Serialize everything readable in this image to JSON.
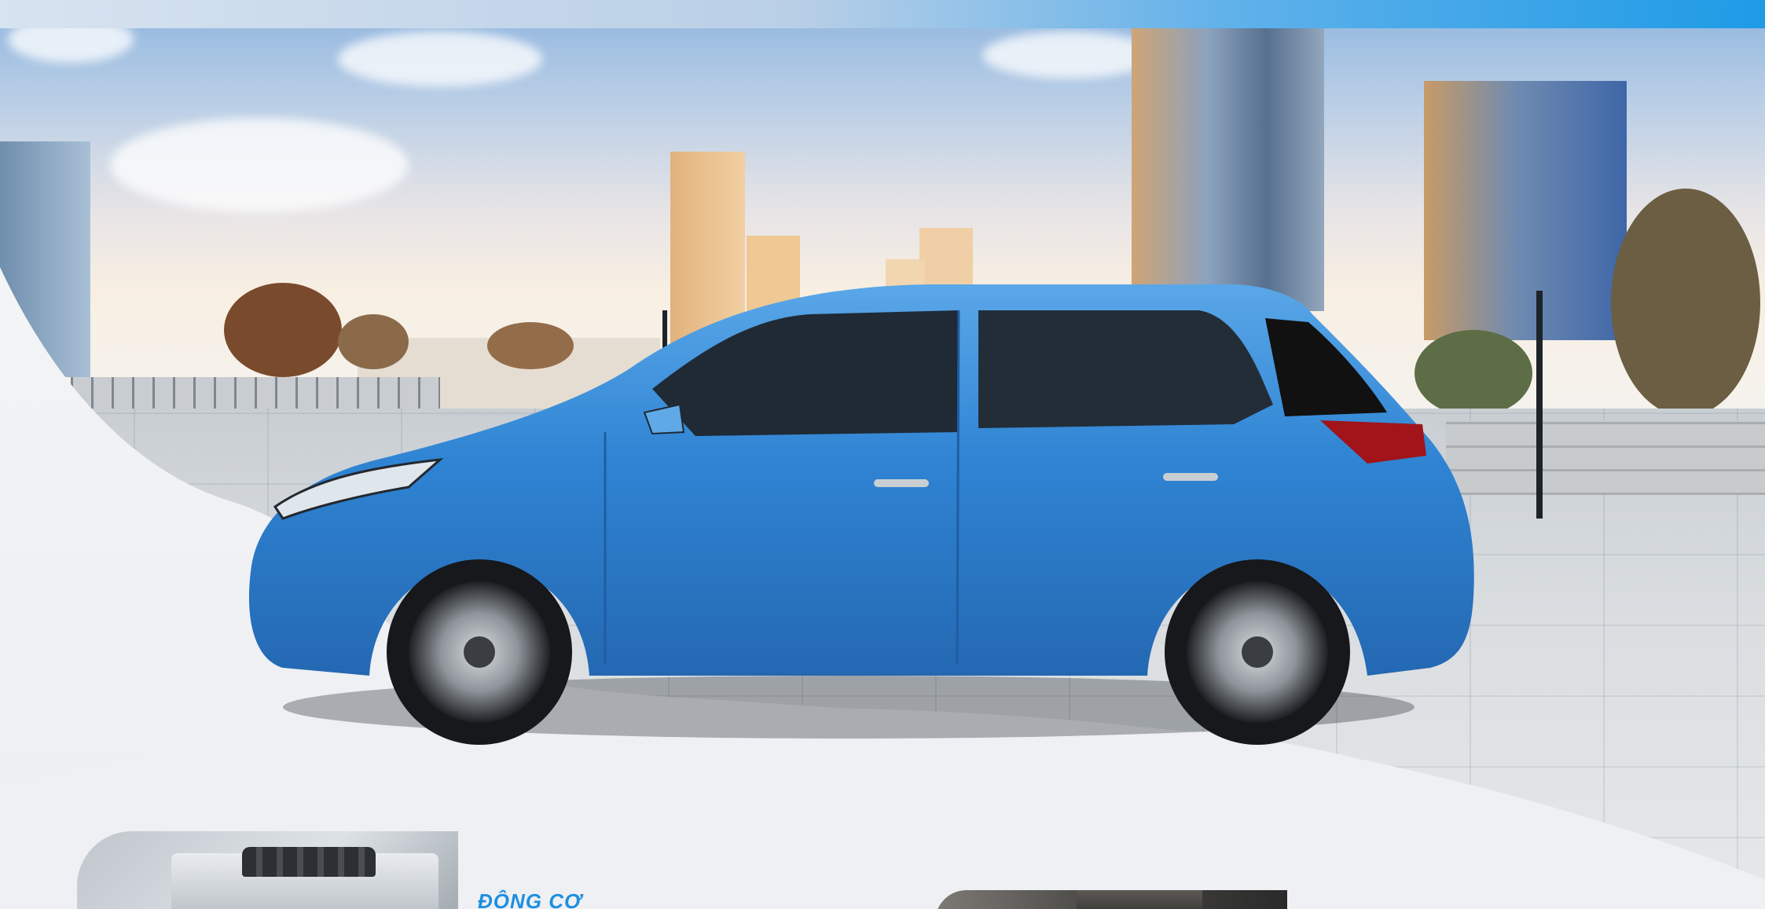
{
  "hero": {
    "car_color": "#3a8fd8",
    "accent_color": "#1d8fe0",
    "scene": [
      "city-skyline",
      "plaza",
      "blue-hatchback-car"
    ]
  },
  "features": {
    "engine": {
      "heading": "ĐỘNG CƠ",
      "image_icon": "engine-photo"
    },
    "interior": {
      "image_icon": "interior-photo"
    }
  }
}
